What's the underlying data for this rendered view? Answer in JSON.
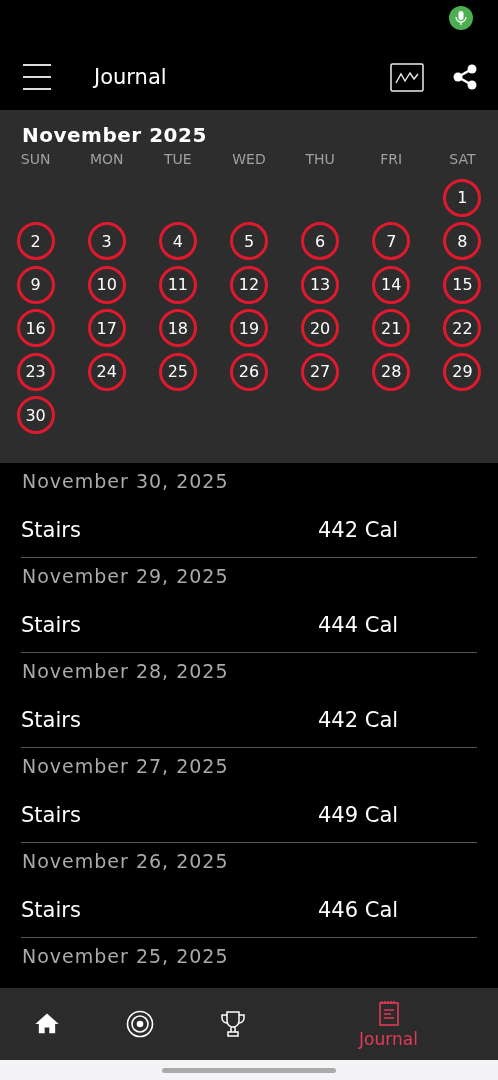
{
  "header": {
    "title": "Journal"
  },
  "calendar": {
    "month": "November 2025",
    "weekdays": [
      "SUN",
      "MON",
      "TUE",
      "WED",
      "THU",
      "FRI",
      "SAT"
    ],
    "weeks": [
      [
        {
          "day": "1",
          "marked": true
        }
      ],
      [
        {
          "day": "2",
          "marked": true
        },
        {
          "day": "3",
          "marked": true
        },
        {
          "day": "4",
          "marked": true
        },
        {
          "day": "5",
          "marked": true
        },
        {
          "day": "6",
          "marked": true
        },
        {
          "day": "7",
          "marked": true
        },
        {
          "day": "8",
          "marked": true
        }
      ],
      [
        {
          "day": "9",
          "marked": true
        },
        {
          "day": "10",
          "marked": true
        },
        {
          "day": "11",
          "marked": true
        },
        {
          "day": "12",
          "marked": true
        },
        {
          "day": "13",
          "marked": true
        },
        {
          "day": "14",
          "marked": true
        },
        {
          "day": "15",
          "marked": true
        }
      ],
      [
        {
          "day": "16",
          "marked": true
        },
        {
          "day": "17",
          "marked": true
        },
        {
          "day": "18",
          "marked": true
        },
        {
          "day": "19",
          "marked": true
        },
        {
          "day": "20",
          "marked": true
        },
        {
          "day": "21",
          "marked": true
        },
        {
          "day": "22",
          "marked": true
        }
      ],
      [
        {
          "day": "23",
          "marked": true
        },
        {
          "day": "24",
          "marked": true
        },
        {
          "day": "25",
          "marked": true
        },
        {
          "day": "26",
          "marked": true
        },
        {
          "day": "27",
          "marked": true
        },
        {
          "day": "28",
          "marked": true
        },
        {
          "day": "29",
          "marked": true
        }
      ],
      [
        {
          "day": "30",
          "marked": true
        }
      ]
    ]
  },
  "entries": [
    {
      "date": "November 30, 2025",
      "activity": "Stairs",
      "calories": "442 Cal"
    },
    {
      "date": "November 29, 2025",
      "activity": "Stairs",
      "calories": "444 Cal"
    },
    {
      "date": "November 28, 2025",
      "activity": "Stairs",
      "calories": "442 Cal"
    },
    {
      "date": "November 27, 2025",
      "activity": "Stairs",
      "calories": "449 Cal"
    },
    {
      "date": "November 26, 2025",
      "activity": "Stairs",
      "calories": "446 Cal"
    },
    {
      "date": "November 25, 2025"
    }
  ],
  "nav": [
    {
      "kind": "home",
      "selected": false
    },
    {
      "kind": "target",
      "selected": false
    },
    {
      "kind": "trophy",
      "selected": false
    },
    {
      "kind": "journal",
      "label": "Journal",
      "selected": true
    }
  ]
}
